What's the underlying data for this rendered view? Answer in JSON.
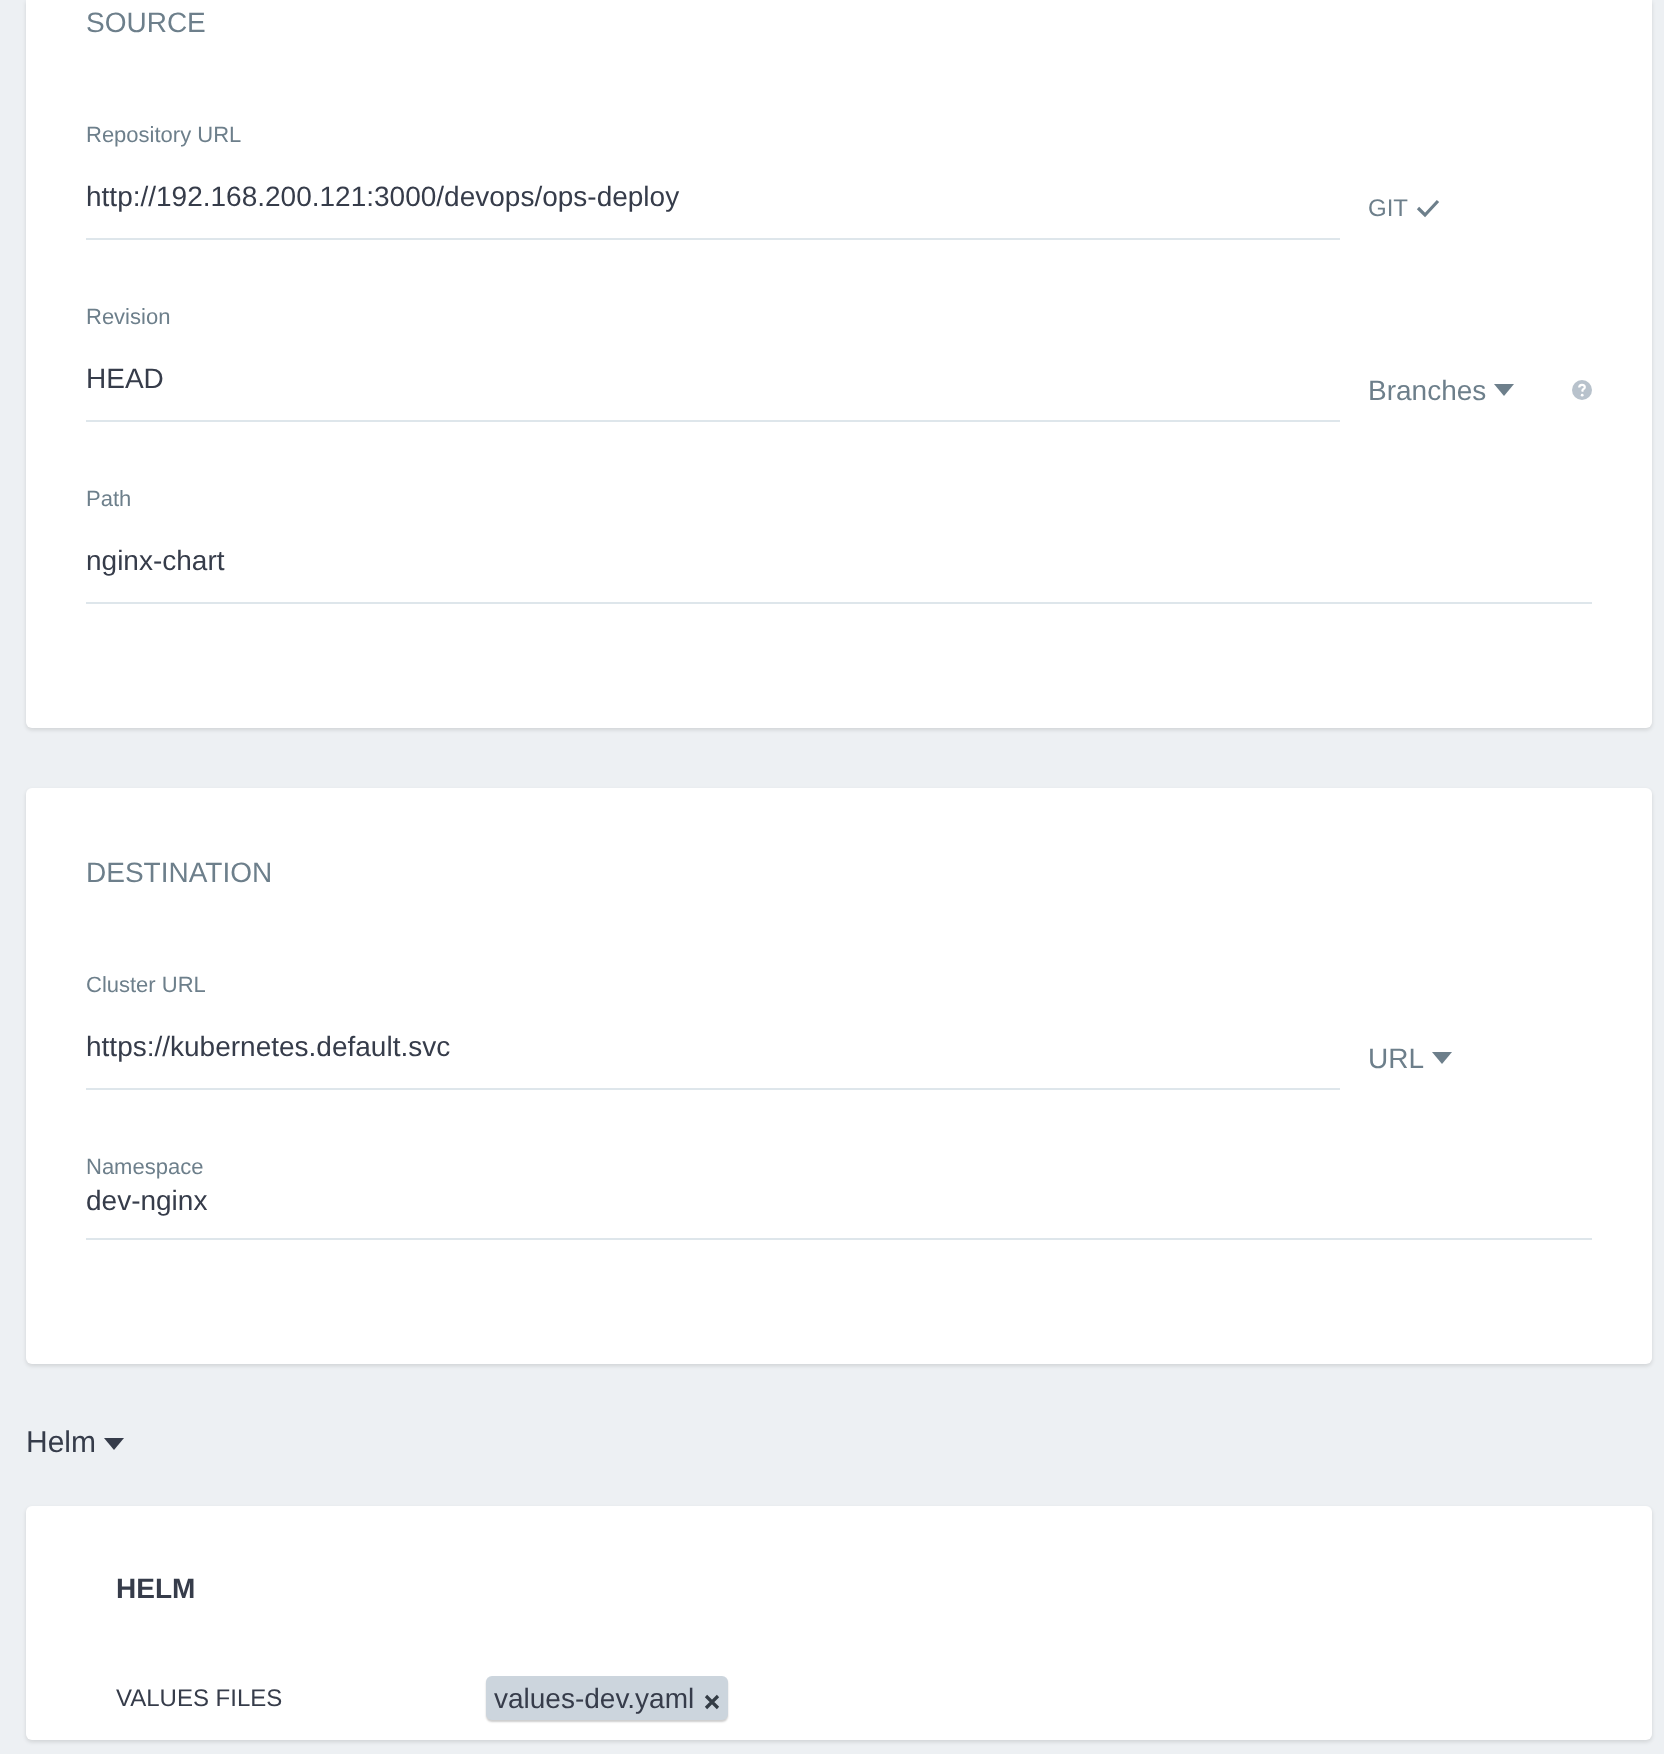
{
  "sections": [
    {
      "title": "SOURCE",
      "fields": [
        {
          "kind": "input",
          "label": "Repository URL",
          "value": "http://192.168.200.121:3000/devops/ops-deploy",
          "accessory": {
            "kind": "check",
            "text": "GIT"
          }
        },
        {
          "kind": "input",
          "label": "Revision",
          "value": "HEAD",
          "accessory": {
            "kind": "dropdown",
            "text": "Branches"
          },
          "help": true
        },
        {
          "kind": "input",
          "label": "Path",
          "value": "nginx-chart"
        }
      ]
    },
    {
      "title": "DESTINATION",
      "fields": [
        {
          "kind": "input",
          "label": "Cluster URL",
          "value": "https://kubernetes.default.svc",
          "accessory": {
            "kind": "dropdown",
            "text": "URL"
          }
        },
        {
          "kind": "autocomplete",
          "label": "Namespace",
          "value": "dev-nginx"
        }
      ]
    }
  ],
  "helm_toggle": {
    "label": "Helm",
    "expanded": true
  },
  "helm": {
    "title": "HELM",
    "rows": [
      {
        "label": "VALUES FILES",
        "chips": [
          "values-dev.yaml"
        ]
      }
    ]
  }
}
